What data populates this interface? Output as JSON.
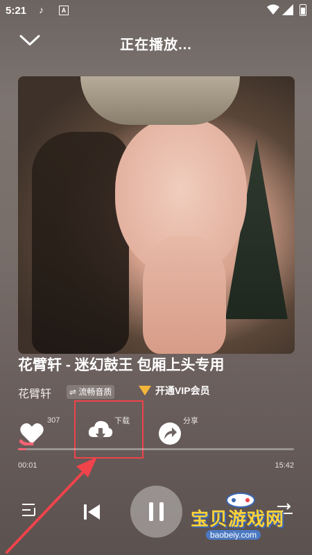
{
  "status_bar": {
    "time": "5:21",
    "tiktok": "♪",
    "a_badge": "A"
  },
  "header": {
    "title": "正在播放..."
  },
  "song": {
    "title": "花臂轩 - 迷幻鼓王 包厢上头专用",
    "artist": "花臂轩",
    "quality": "⇌ 流畅音质",
    "vip_label": "开通VIP会员"
  },
  "actions": {
    "like_count": "307",
    "download_label": "下载",
    "share_label": "分享"
  },
  "playback": {
    "current_time": "00:01",
    "total_time": "15:42",
    "progress_fraction": 0.005
  },
  "watermark": {
    "main": "宝贝游戏网",
    "sub": "baobeiy.com"
  },
  "colors": {
    "accent": "#f26475",
    "highlight_box": "#f0434b",
    "vip_gold": "#f4b63a"
  }
}
